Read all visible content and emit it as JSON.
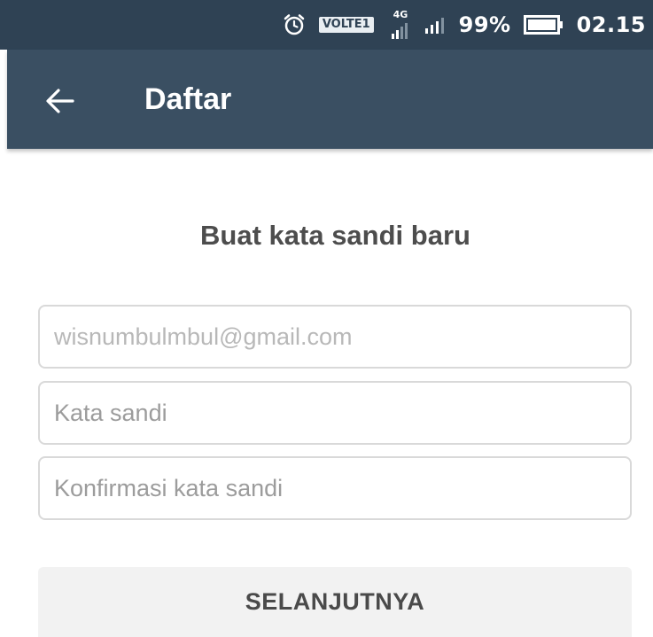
{
  "status_bar": {
    "volte_label": "VOLTE1",
    "network_label": "4G",
    "battery_percent": "99%",
    "time": "02.15",
    "icons": [
      "alarm-icon",
      "signal-4g-icon",
      "signal-icon",
      "battery-icon"
    ]
  },
  "app_bar": {
    "back_icon": "arrow-left-icon",
    "title": "Daftar",
    "background_color": "#3a4f62"
  },
  "form": {
    "heading": "Buat kata sandi baru",
    "email_placeholder": "wisnumbulmbul@gmail.com",
    "password_placeholder": "Kata sandi",
    "confirm_placeholder": "Konfirmasi kata sandi",
    "next_button_label": "SELANJUTNYA"
  }
}
